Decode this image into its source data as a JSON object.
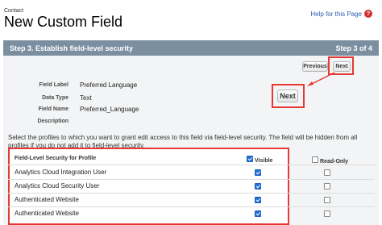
{
  "header": {
    "breadcrumb": "Contact",
    "title": "New Custom Field",
    "help_link": "Help for this Page",
    "help_icon": "question-icon"
  },
  "stepbar": {
    "title": "Step 3. Establish field-level security",
    "step": "Step 3 of 4"
  },
  "buttons": {
    "previous": "Previous",
    "next": "Next",
    "next_large": "Next"
  },
  "fields": [
    {
      "label": "Field Label",
      "value": "Preferred Language"
    },
    {
      "label": "Data Type",
      "value": "Text"
    },
    {
      "label": "Field Name",
      "value": "Preferred_Language"
    },
    {
      "label": "Description",
      "value": ""
    }
  ],
  "instructions": "Select the profiles to which you want to grant edit access to this field via field-level security. The field will be hidden from all profiles if you do not add it to field-level security.",
  "table": {
    "col_profile": "Field-Level Security for Profile",
    "col_visible": "Visible",
    "col_readonly": "Read-Only",
    "rows": [
      {
        "profile": "Analytics Cloud Integration User",
        "visible": true,
        "read_only": false
      },
      {
        "profile": "Analytics Cloud Security User",
        "visible": true,
        "read_only": false
      },
      {
        "profile": "Authenticated Website",
        "visible": true,
        "read_only": false
      },
      {
        "profile": "Authenticated Website",
        "visible": true,
        "read_only": false
      }
    ]
  },
  "colors": {
    "step_bar": "#7b8fa1",
    "highlight": "#e53935",
    "checkbox_checked": "#1e6fd9",
    "link": "#2a5db0"
  }
}
